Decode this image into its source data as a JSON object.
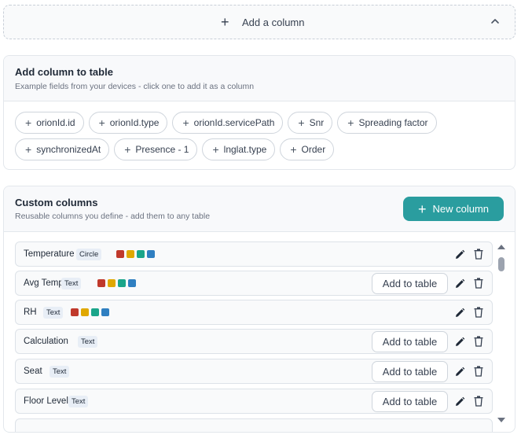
{
  "add_bar": {
    "label": "Add a column",
    "icon": "plus-icon",
    "toggle_icon": "chevron-up-icon"
  },
  "field_card": {
    "title": "Add column to table",
    "subtitle": "Example fields from your devices - click one to add it as a column",
    "fields_row1": [
      "orionId.id",
      "orionId.type",
      "orionId.servicePath",
      "Snr",
      "Spreading factor"
    ],
    "fields_row2": [
      "synchronizedAt",
      "Presence - 1",
      "lnglat.type",
      "Order"
    ]
  },
  "custom_card": {
    "title": "Custom columns",
    "subtitle": "Reusable columns you define - add them to any table",
    "new_button": "New column",
    "add_to_table_label": "Add to table",
    "swatch_colors": [
      "#c0392b",
      "#e0a800",
      "#1aa58a",
      "#2f7fc1"
    ],
    "columns": [
      {
        "name": "Temperature",
        "type": "Circle",
        "has_swatches": true,
        "show_add": false
      },
      {
        "name": "Avg Temp",
        "type": "Text",
        "has_swatches": true,
        "show_add": true
      },
      {
        "name": "RH",
        "type": "Text",
        "has_swatches": true,
        "show_add": false
      },
      {
        "name": "Calculation",
        "type": "Text",
        "has_swatches": false,
        "show_add": true
      },
      {
        "name": "Seat",
        "type": "Text",
        "has_swatches": false,
        "show_add": true
      },
      {
        "name": "Floor Level",
        "type": "Text",
        "has_swatches": false,
        "show_add": true
      }
    ]
  },
  "colors": {
    "accent": "#2a9d9f"
  }
}
